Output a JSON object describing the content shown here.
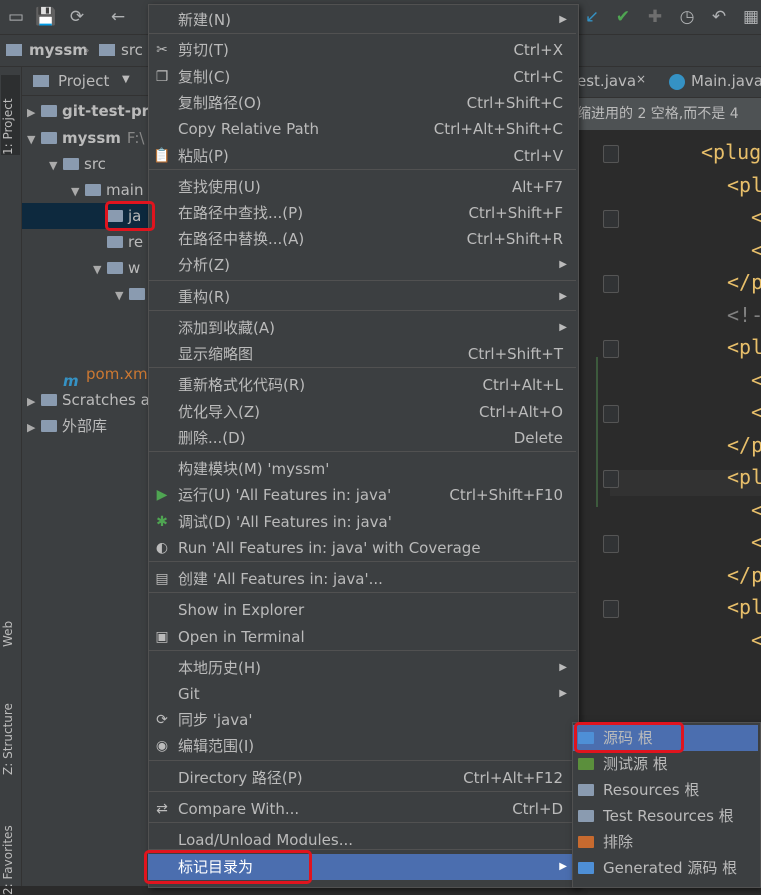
{
  "breadcrumb": {
    "project": "myssm",
    "folder": "src"
  },
  "left_stripe": {
    "project_tab": "1: Project",
    "web_tab": "Web",
    "structure_tab": "Z: Structure",
    "favorites_tab": "2: Favorites"
  },
  "project_panel": {
    "header": "Project",
    "tree": [
      {
        "label": "git-test-pr",
        "level": 0,
        "arrow": "▶",
        "bold": true
      },
      {
        "label": "myssm",
        "suffix": "F:\\",
        "level": 0,
        "arrow": "▼",
        "bold": true
      },
      {
        "label": "src",
        "level": 1,
        "arrow": "▼"
      },
      {
        "label": "main",
        "level": 2,
        "arrow": "▼"
      },
      {
        "label": "ja",
        "level": 3,
        "arrow": "",
        "selected": true
      },
      {
        "label": "re",
        "level": 3,
        "arrow": ""
      },
      {
        "label": "w",
        "level": 3,
        "arrow": "▼"
      },
      {
        "label": "",
        "level": 4,
        "arrow": "▼"
      },
      {
        "label": "pom.xm",
        "level": 1,
        "arrow": "",
        "file": true
      },
      {
        "label": "Scratches a",
        "level": 0,
        "arrow": "▶"
      },
      {
        "label": "外部库",
        "level": 0,
        "arrow": "▶"
      }
    ]
  },
  "editor": {
    "tabs": [
      {
        "label": "est.java"
      },
      {
        "label": "Main.java"
      }
    ],
    "notice": "缩进用的 2 空格,而不是 4",
    "lines": [
      "<plug",
      "<pl",
      "<",
      "<",
      "</p",
      "<!-",
      "<pl",
      "<",
      "<",
      "</p",
      "<pl",
      "<",
      "<",
      "</p",
      "<pl",
      "<"
    ]
  },
  "context_menu": {
    "items": [
      {
        "label": "新建(N)",
        "shortcut": "",
        "submenu": true,
        "icon": ""
      },
      {
        "label": "剪切(T)",
        "shortcut": "Ctrl+X",
        "icon": "✂"
      },
      {
        "label": "复制(C)",
        "shortcut": "Ctrl+C",
        "icon": "❐"
      },
      {
        "label": "复制路径(O)",
        "shortcut": "Ctrl+Shift+C",
        "icon": ""
      },
      {
        "label": "Copy Relative Path",
        "shortcut": "Ctrl+Alt+Shift+C",
        "icon": ""
      },
      {
        "label": "粘贴(P)",
        "shortcut": "Ctrl+V",
        "icon": "📋"
      },
      {
        "label": "查找使用(U)",
        "shortcut": "Alt+F7",
        "icon": ""
      },
      {
        "label": "在路径中查找...(P)",
        "shortcut": "Ctrl+Shift+F",
        "icon": ""
      },
      {
        "label": "在路径中替换...(A)",
        "shortcut": "Ctrl+Shift+R",
        "icon": ""
      },
      {
        "label": "分析(Z)",
        "shortcut": "",
        "submenu": true,
        "icon": ""
      },
      {
        "label": "重构(R)",
        "shortcut": "",
        "submenu": true,
        "icon": ""
      },
      {
        "label": "添加到收藏(A)",
        "shortcut": "",
        "submenu": true,
        "icon": ""
      },
      {
        "label": "显示缩略图",
        "shortcut": "Ctrl+Shift+T",
        "icon": ""
      },
      {
        "label": "重新格式化代码(R)",
        "shortcut": "Ctrl+Alt+L",
        "icon": ""
      },
      {
        "label": "优化导入(Z)",
        "shortcut": "Ctrl+Alt+O",
        "icon": ""
      },
      {
        "label": "删除...(D)",
        "shortcut": "Delete",
        "icon": ""
      },
      {
        "label": "构建模块(M) 'myssm'",
        "shortcut": "",
        "icon": ""
      },
      {
        "label": "运行(U) 'All Features in: java'",
        "shortcut": "Ctrl+Shift+F10",
        "icon": "▶"
      },
      {
        "label": "调试(D) 'All Features in: java'",
        "shortcut": "",
        "icon": "✱"
      },
      {
        "label": "Run 'All Features in: java' with Coverage",
        "shortcut": "",
        "icon": "◐"
      },
      {
        "label": "创建 'All Features in: java'...",
        "shortcut": "",
        "icon": "▤"
      },
      {
        "label": "Show in Explorer",
        "shortcut": "",
        "icon": ""
      },
      {
        "label": "Open in Terminal",
        "shortcut": "",
        "icon": "▣"
      },
      {
        "label": "本地历史(H)",
        "shortcut": "",
        "submenu": true,
        "icon": ""
      },
      {
        "label": "Git",
        "shortcut": "",
        "submenu": true,
        "icon": ""
      },
      {
        "label": "同步 'java'",
        "shortcut": "",
        "icon": "⟳"
      },
      {
        "label": "编辑范围(I)",
        "shortcut": "",
        "icon": "◉"
      },
      {
        "label": "Directory 路径(P)",
        "shortcut": "Ctrl+Alt+F12",
        "icon": ""
      },
      {
        "label": "Compare With...",
        "shortcut": "Ctrl+D",
        "icon": "⇄"
      },
      {
        "label": "Load/Unload Modules...",
        "shortcut": "",
        "icon": ""
      },
      {
        "label": "标记目录为",
        "shortcut": "",
        "submenu": true,
        "icon": "",
        "highlighted": true
      }
    ]
  },
  "submenu": {
    "items": [
      {
        "label": "源码 根",
        "color": "#4e8fd6",
        "highlighted": true
      },
      {
        "label": "测试源 根",
        "color": "#5b8f3c"
      },
      {
        "label": "Resources 根",
        "color": "#8a9bb0"
      },
      {
        "label": "Test Resources 根",
        "color": "#8a9bb0"
      },
      {
        "label": "排除",
        "color": "#c76a2f"
      },
      {
        "label": "Generated 源码 根",
        "color": "#4e8fd6"
      }
    ]
  },
  "colors": {
    "highlight": "#4b6eaf",
    "annotation_red": "#e0141e",
    "menu_bg": "#3c3f41"
  }
}
